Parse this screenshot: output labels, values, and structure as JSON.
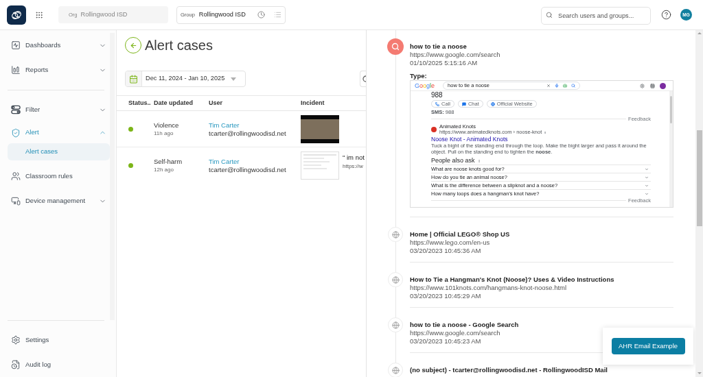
{
  "top_bar": {
    "org": {
      "label": "Org",
      "value": "Rollingwood ISD",
      "disabled": true
    },
    "group": {
      "label": "Group",
      "value": "Rollingwood ISD"
    },
    "search": {
      "placeholder": "Search users and groups..."
    },
    "avatar": {
      "initials": "MG"
    }
  },
  "sidebar": {
    "sections": [
      {
        "items": [
          {
            "label": "Dashboards",
            "kind": "group",
            "expanded": false,
            "selected": false
          },
          {
            "label": "Reports",
            "kind": "group",
            "expanded": false,
            "selected": false
          }
        ]
      },
      {
        "items": [
          {
            "label": "Filter",
            "kind": "group",
            "expanded": false,
            "selected": false
          },
          {
            "label": "Alert",
            "kind": "group",
            "expanded": true,
            "selected": true,
            "children": [
              {
                "label": "Alert cases",
                "selected": true
              }
            ]
          },
          {
            "label": "Classroom rules",
            "kind": "link",
            "selected": false
          },
          {
            "label": "Device management",
            "kind": "group",
            "expanded": false,
            "selected": false
          }
        ]
      }
    ],
    "footer": [
      {
        "label": "Settings",
        "selected": false
      },
      {
        "label": "Audit log",
        "selected": false
      }
    ]
  },
  "page": {
    "title": "Alert cases",
    "date_range": "Dec 11, 2024 - Jan 10, 2025",
    "table": {
      "columns": [
        "Status..",
        "Date updated",
        "User",
        "Incident"
      ],
      "rows": [
        {
          "status": {
            "color": "#7cb518"
          },
          "category": "Violence",
          "updated": "11h ago",
          "user": {
            "name": "Tim Carter",
            "email": "tcarter@rollingwoodisd.net"
          },
          "incident": {
            "kind": "photo"
          }
        },
        {
          "status": {
            "color": "#7cb518"
          },
          "category": "Self-harm",
          "updated": "12h ago",
          "user": {
            "name": "Tim Carter",
            "email": "tcarter@rollingwoodisd.net"
          },
          "incident": {
            "kind": "screenshot",
            "text": "\" im not",
            "url": "https://w"
          }
        }
      ]
    }
  },
  "activity": {
    "items": [
      {
        "kind": "search",
        "title": "how to tie a noose",
        "url": "https://www.google.com/search",
        "time": "01/10/2025 5:15:16 AM",
        "type_label": "Type:",
        "screenshot": {
          "logo": "Google",
          "query": "how to tie a noose",
          "answer": "988",
          "actions": [
            {
              "kind": "call",
              "label": "Call"
            },
            {
              "kind": "chat",
              "label": "Chat"
            },
            {
              "kind": "website",
              "label": "Official Website"
            }
          ],
          "sms": "**SMS:** 988",
          "feedback": "Feedback",
          "result": {
            "site": "Animated Knots",
            "url": "https://www.animatedknots.com › noose-knot",
            "title": "Noose Knot - Animated Knots",
            "snippet": "Tuck a bight of the standing end through the loop. Make the bight larger and pass it around the object. Pull on the standing end to tighten the **noose**."
          },
          "people_also_ask": {
            "heading": "People also ask",
            "questions": [
              "What are noose knots good for?",
              "How do you tie an animal noose?",
              "What is the difference between a slipknot and a noose?",
              "How many loops does a hangman's knot have?"
            ],
            "feedback": "Feedback"
          }
        }
      },
      {
        "kind": "web",
        "title": "Home | Official LEGO® Shop US",
        "url": "https://www.lego.com/en-us",
        "time": "03/20/2023 10:45:36 AM"
      },
      {
        "kind": "web",
        "title": "How to Tie a Hangman's Knot (Noose)? Uses & Video Instructions",
        "url": "https://www.101knots.com/hangmans-knot-noose.html",
        "time": "03/20/2023 10:45:29 AM"
      },
      {
        "kind": "web",
        "title": "how to tie a noose - Google Search",
        "url": "https://www.google.com/search",
        "time": "03/20/2023 10:45:23 AM"
      },
      {
        "kind": "web",
        "title": "(no subject) - tcarter@rollingwoodisd.net - RollingwoodISD Mail"
      }
    ]
  },
  "floating_button": {
    "label": "AHR Email Example"
  }
}
